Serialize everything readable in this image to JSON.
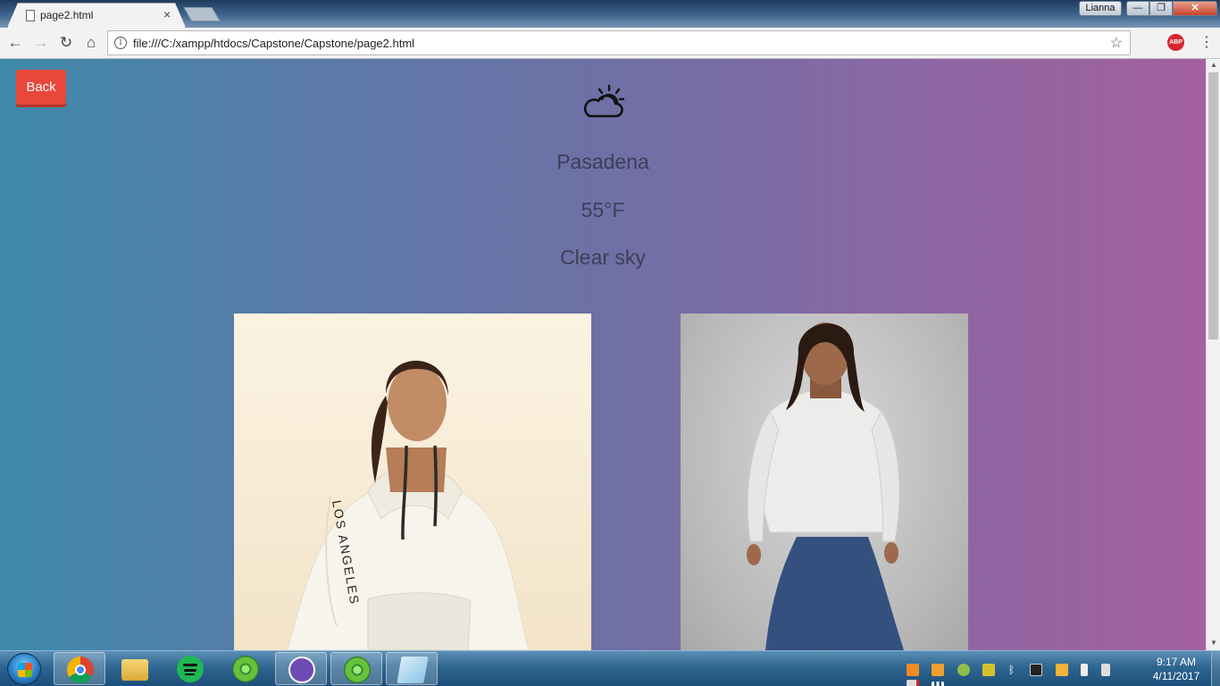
{
  "browser": {
    "tab_title": "page2.html",
    "tab_close": "×",
    "url": "file:///C:/xampp/htdocs/Capstone/Capstone/page2.html",
    "user_label": "Lianna",
    "abp_label": "ABP",
    "window_controls": {
      "minimize": "—",
      "maximize": "❐",
      "close": "✕"
    },
    "nav_icons": {
      "back": "←",
      "forward": "→",
      "reload": "↻",
      "home": "⌂",
      "info": "i",
      "bookmark": "☆",
      "menu": "⋮"
    }
  },
  "page": {
    "back_label": "Back",
    "weather_icon": "partly-cloudy-day-icon",
    "city": "Pasadena",
    "temperature": "55°F",
    "condition": "Clear sky",
    "outfits": [
      {
        "name": "white hoodie with graphic sleeves",
        "icon": "outfit-photo"
      },
      {
        "name": "satin white hoodie with jeans",
        "icon": "outfit-photo"
      }
    ]
  },
  "taskbar": {
    "apps": [
      "chrome-icon",
      "file-explorer-icon",
      "spotify-icon",
      "atom-icon",
      "github-desktop-icon",
      "atom-icon",
      "notepad-icon"
    ],
    "clock_time": "9:17 AM",
    "clock_date": "4/11/2017"
  },
  "colors": {
    "gradient_left": "#3f8aab",
    "gradient_right": "#a460a0",
    "back_button": "#e8473a",
    "weather_text": "#3c3f59"
  }
}
